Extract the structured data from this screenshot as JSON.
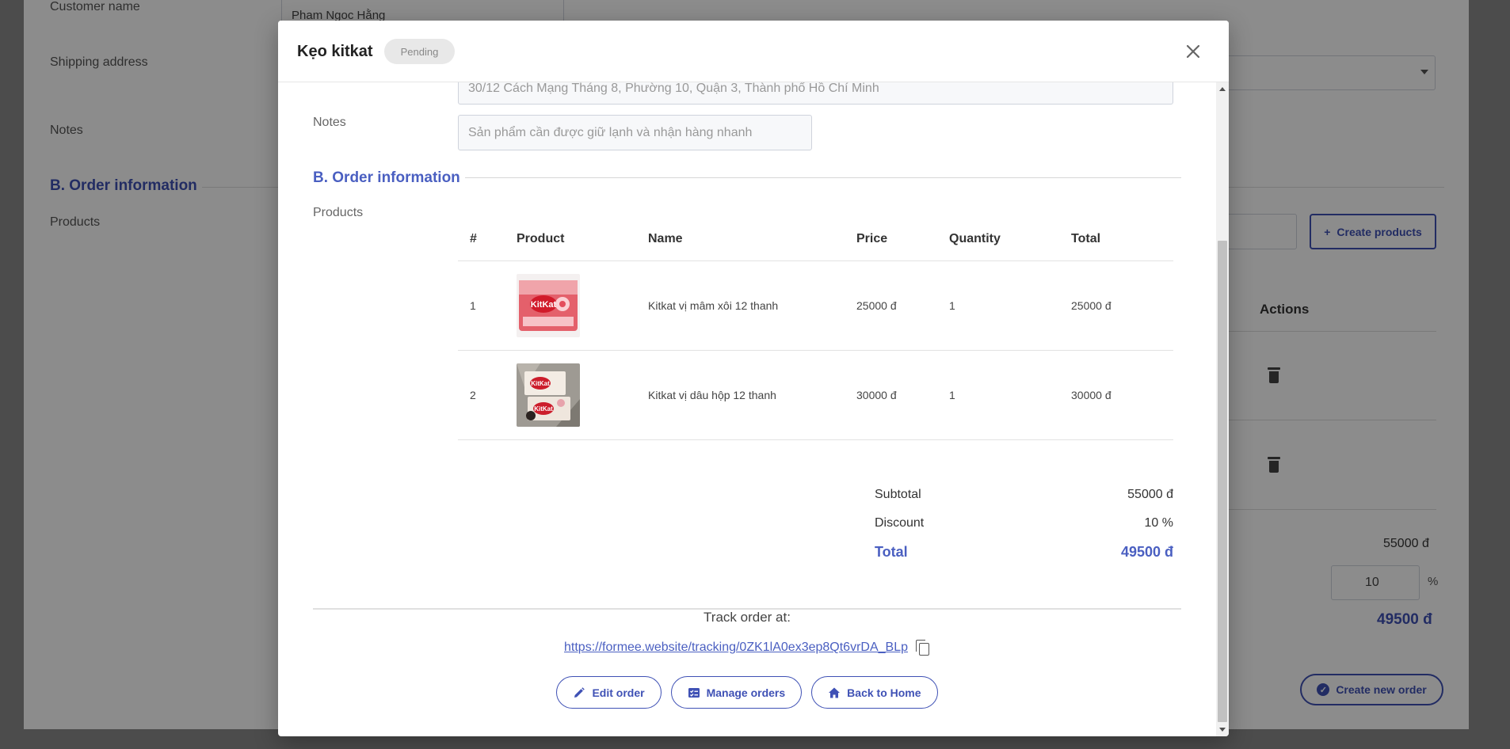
{
  "background": {
    "customer_name_label": "Customer name",
    "customer_name_value": "Pham Ngoc Hằng",
    "shipping_address_label": "Shipping address",
    "notes_label": "Notes",
    "section_title": "B. Order information",
    "products_label": "Products",
    "create_products_label": "Create products",
    "actions_header": "Actions",
    "subtotal_value": "55000 đ",
    "discount_value": "10",
    "discount_unit": "%",
    "total_value": "49500 đ",
    "create_order_label": "Create new order"
  },
  "modal": {
    "title": "Kẹo kitkat",
    "status": "Pending",
    "shipping_address_value": "30/12 Cách Mạng Tháng 8, Phường 10, Quận 3, Thành phố Hồ Chí Minh",
    "notes_label": "Notes",
    "notes_placeholder": "Sản phẩm cần được giữ lạnh và nhận hàng nhanh",
    "section_title": "B. Order information",
    "products_label": "Products",
    "table": {
      "headers": [
        "#",
        "Product",
        "Name",
        "Price",
        "Quantity",
        "Total"
      ],
      "rows": [
        {
          "index": "1",
          "image": "kitkat-raspberry-pack",
          "name": "Kitkat vị mâm xôi 12 thanh",
          "price": "25000 đ",
          "quantity": "1",
          "total": "25000 đ"
        },
        {
          "index": "2",
          "image": "kitkat-strawberry-box",
          "name": "Kitkat vị dâu hộp 12 thanh",
          "price": "30000 đ",
          "quantity": "1",
          "total": "30000 đ"
        }
      ]
    },
    "summary": {
      "subtotal_label": "Subtotal",
      "subtotal_value": "55000 đ",
      "discount_label": "Discount",
      "discount_value": "10 %",
      "total_label": "Total",
      "total_value": "49500 đ"
    },
    "track_label": "Track order at:",
    "track_link": "https://formee.website/tracking/0ZK1lA0ex3ep8Qt6vrDA_BLp",
    "buttons": {
      "edit": "Edit order",
      "manage": "Manage orders",
      "home": "Back to Home"
    }
  },
  "colors": {
    "accent": "#3f51b5",
    "accent_text": "#4a5fc1",
    "badge_bg": "#e8e8e8"
  },
  "icons": [
    "close-icon",
    "copy-icon",
    "pencil-icon",
    "list-check-icon",
    "home-icon",
    "trash-icon",
    "plus-icon",
    "check-circle-icon"
  ]
}
